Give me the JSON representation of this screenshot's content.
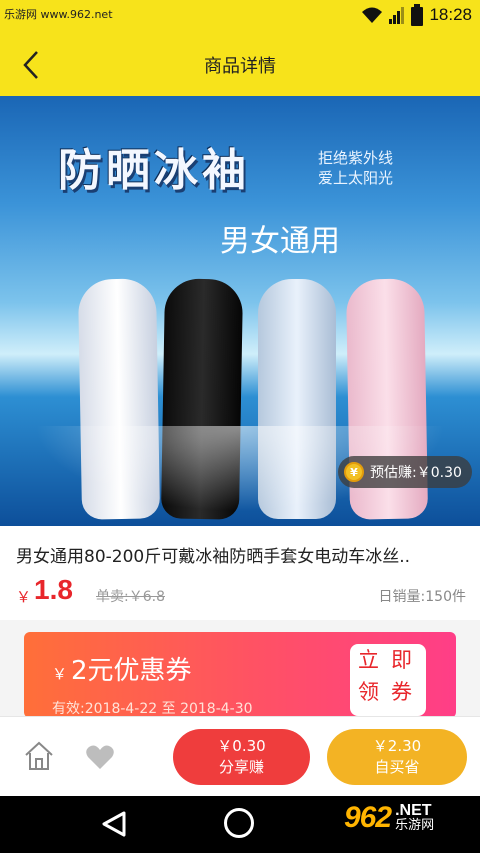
{
  "status_bar": {
    "watermark": "乐游网 www.962.net",
    "time": "18:28",
    "icons": [
      "wifi-icon",
      "signal-icon",
      "battery-icon"
    ]
  },
  "nav": {
    "title": "商品详情",
    "back_icon": "chevron-left-icon"
  },
  "hero": {
    "headline": "防晒冰袖",
    "tagline_1": "拒绝紫外线",
    "tagline_2": "爱上太阳光",
    "subhead": "男女通用",
    "earn_badge": {
      "coin": "¥",
      "text": "预估赚:￥0.30"
    }
  },
  "product": {
    "title": "男女通用80-200斤可戴冰袖防晒手套女电动车冰丝..",
    "price_symbol": "￥",
    "price": "1.8",
    "original_price": "单卖:￥6.8",
    "daily_sales": "日销量:150件"
  },
  "coupon": {
    "yen": "￥",
    "amount_text": "2元优惠券",
    "validity": "有效:2018-4-22 至 2018-4-30",
    "claim_label": "立即领券"
  },
  "bottom_bar": {
    "home_icon": "home-icon",
    "favorite_icon": "heart-icon",
    "share": {
      "amount": "￥0.30",
      "label": "分享赚"
    },
    "buy": {
      "amount": "￥2.30",
      "label": "自买省"
    }
  },
  "system_nav": {
    "logo_number": "962",
    "logo_suffix": ".NET",
    "logo_text": "乐游网"
  },
  "colors": {
    "accent_yellow": "#f7e31b",
    "price_red": "#e8262b",
    "share_red": "#ef3d3d",
    "buy_orange": "#f3b324"
  }
}
